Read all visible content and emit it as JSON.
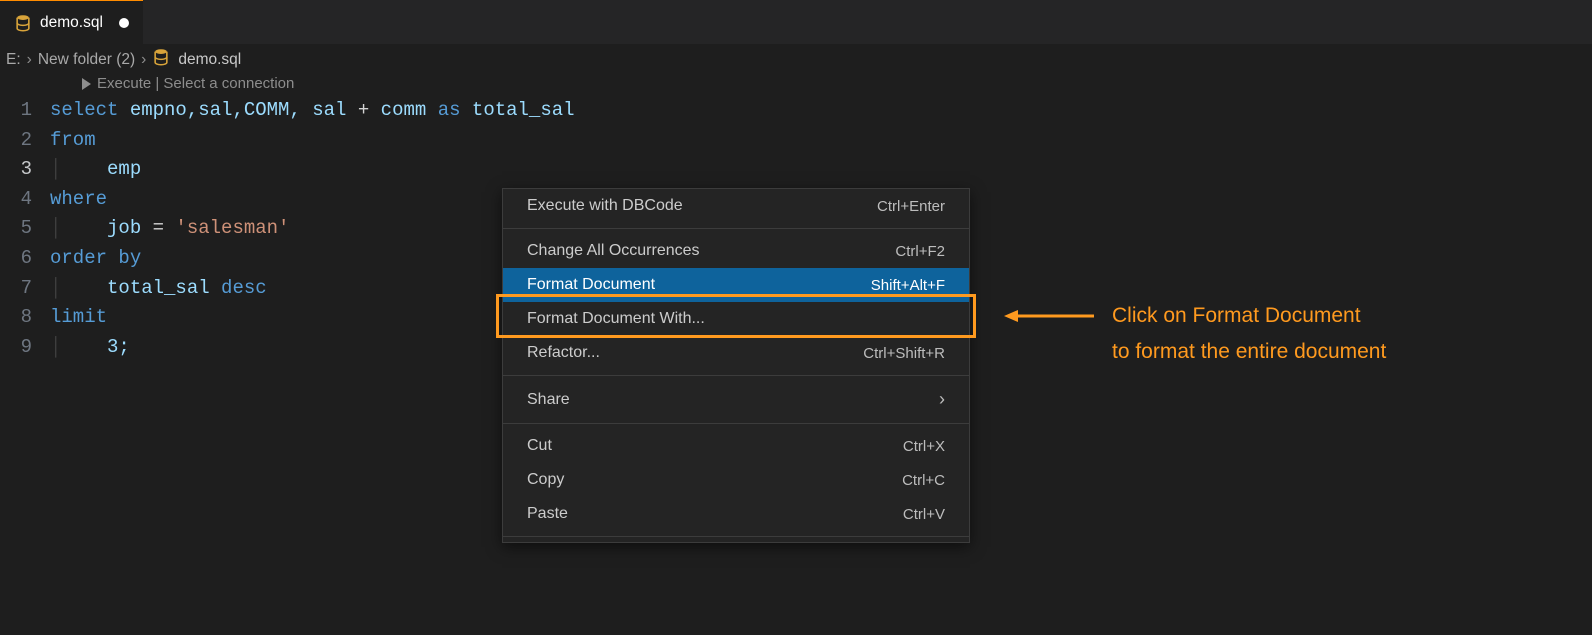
{
  "tab": {
    "label": "demo.sql"
  },
  "breadcrumbs": {
    "seg0": "E:",
    "seg1": "New folder (2)",
    "seg2": "demo.sql"
  },
  "codelens": {
    "text": "Execute | Select a connection"
  },
  "gutter": {
    "l1": "1",
    "l2": "2",
    "l3": "3",
    "l4": "4",
    "l5": "5",
    "l6": "6",
    "l7": "7",
    "l8": "8",
    "l9": "9"
  },
  "code": {
    "l1_kw": "select",
    "l1_ids": " empno,sal,COMM, sal ",
    "l1_plus": "+",
    "l1_comm": " comm ",
    "l1_as": "as",
    "l1_tot": " total_sal",
    "l2_kw": "from",
    "l3_txt": "    emp",
    "l4_kw": "where",
    "l5_txt": "    job ",
    "l5_eq": "=",
    "l5_str": " 'salesman'",
    "l6_kw": "order by",
    "l7_txt": "    total_sal ",
    "l7_desc": "desc",
    "l8_kw": "limit",
    "l9_txt": "    3;"
  },
  "menu": {
    "execute": {
      "label": "Execute with DBCode",
      "sc": "Ctrl+Enter"
    },
    "changeAll": {
      "label": "Change All Occurrences",
      "sc": "Ctrl+F2"
    },
    "format": {
      "label": "Format Document",
      "sc": "Shift+Alt+F"
    },
    "formatWith": {
      "label": "Format Document With..."
    },
    "refactor": {
      "label": "Refactor...",
      "sc": "Ctrl+Shift+R"
    },
    "share": {
      "label": "Share"
    },
    "cut": {
      "label": "Cut",
      "sc": "Ctrl+X"
    },
    "copy": {
      "label": "Copy",
      "sc": "Ctrl+C"
    },
    "paste": {
      "label": "Paste",
      "sc": "Ctrl+V"
    }
  },
  "annotation": {
    "line1": "Click on Format Document",
    "line2": "to format the entire document"
  }
}
